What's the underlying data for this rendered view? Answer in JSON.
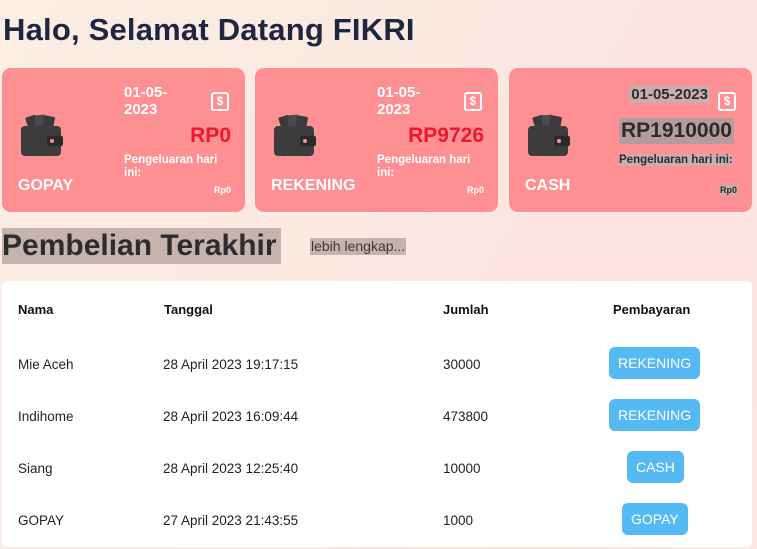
{
  "greeting": "Halo, Selamat Datang FIKRI",
  "cards": [
    {
      "name": "GOPAY",
      "date": "01-05-2023",
      "amount": "RP0",
      "spend_label": "Pengeluaran hari ini:",
      "spend_value": "Rp0"
    },
    {
      "name": "REKENING",
      "date": "01-05-2023",
      "amount": "RP9726",
      "spend_label": "Pengeluaran hari ini:",
      "spend_value": "Rp0"
    },
    {
      "name": "CASH",
      "date": "01-05-2023",
      "amount": "RP1910000",
      "spend_label": "Pengeluaran hari ini:",
      "spend_value": "Rp0"
    }
  ],
  "icons": {
    "wallet": "wallet-icon",
    "dollar": "dollar-sign-icon"
  },
  "colors": {
    "card_bg": "#fe8f93",
    "amount_red": "#f0162d",
    "badge_blue": "#55b9f4",
    "title": "#1f2740"
  },
  "recent": {
    "title": "Pembelian Terakhir",
    "more_link": "lebih lengkap..."
  },
  "table": {
    "headers": [
      "Nama",
      "Tanggal",
      "Jumlah",
      "Pembayaran"
    ],
    "rows": [
      {
        "nama": "Mie Aceh",
        "tanggal": "28 April 2023 19:17:15",
        "jumlah": "30000",
        "pembayaran": "REKENING"
      },
      {
        "nama": "Indihome",
        "tanggal": "28 April 2023 16:09:44",
        "jumlah": "473800",
        "pembayaran": "REKENING"
      },
      {
        "nama": "Siang",
        "tanggal": "28 April 2023 12:25:40",
        "jumlah": "10000",
        "pembayaran": "CASH"
      },
      {
        "nama": "GOPAY",
        "tanggal": "27 April 2023 21:43:55",
        "jumlah": "1000",
        "pembayaran": "GOPAY"
      }
    ]
  }
}
